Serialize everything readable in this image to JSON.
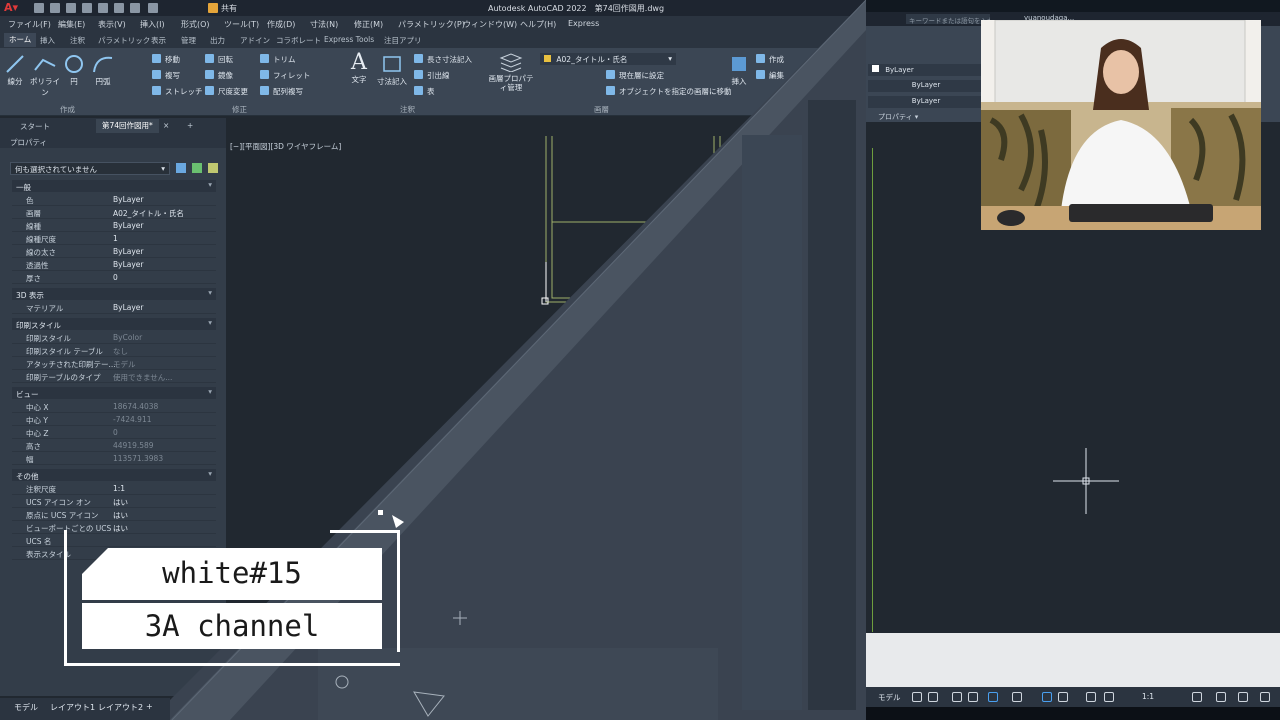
{
  "titlebar": {
    "title": "Autodesk AutoCAD 2022　第74回作図用.dwg",
    "share": "共有"
  },
  "menubar": [
    "ファイル(F)",
    "編集(E)",
    "表示(V)",
    "挿入(I)",
    "形式(O)",
    "ツール(T)",
    "作成(D)",
    "寸法(N)",
    "修正(M)",
    "パラメトリック(P)",
    "ウィンドウ(W)",
    "ヘルプ(H)",
    "Express"
  ],
  "ribbon_tabs": [
    "ホーム",
    "挿入",
    "注釈",
    "パラメトリック",
    "表示",
    "管理",
    "出力",
    "アドイン",
    "コラボレート",
    "Express Tools",
    "注目アプリ"
  ],
  "ribbon": {
    "draw": {
      "line": "線分",
      "polyline": "ポリライン",
      "circle": "円",
      "arc": "円弧",
      "group": "作成"
    },
    "modify": {
      "move": "移動",
      "rotate": "回転",
      "trim": "トリム",
      "copy": "複写",
      "mirror": "鏡像",
      "fillet": "フィレット",
      "stretch": "ストレッチ",
      "scale": "尺度変更",
      "array": "配列複写",
      "group": "修正"
    },
    "annotation": {
      "text": "文字",
      "dimension": "寸法記入",
      "linear": "長さ寸法記入",
      "leader": "引出線",
      "table": "表",
      "group": "注釈"
    },
    "layers": {
      "current": "A02_タイトル・氏名",
      "props": "画層プロパティ管理",
      "setcurrent": "現在層に設定",
      "matchlayer": "オブジェクトを指定の画層に移動",
      "group": "画層"
    },
    "block": {
      "insert": "挿入",
      "create": "作成",
      "edit": "編集"
    }
  },
  "doctabs": {
    "start": "スタート",
    "active": "第74回作図用*",
    "close": "×",
    "plus": "+"
  },
  "props": {
    "title": "プロパティ",
    "selection": "何も選択されていません",
    "general_title": "一般",
    "general": [
      [
        "色",
        "ByLayer"
      ],
      [
        "画層",
        "A02_タイトル・氏名"
      ],
      [
        "線種",
        "ByLayer"
      ],
      [
        "線種尺度",
        "1"
      ],
      [
        "線の太さ",
        "ByLayer"
      ],
      [
        "透過性",
        "ByLayer"
      ],
      [
        "厚さ",
        "0"
      ]
    ],
    "view3d_title": "3D 表示",
    "view3d": [
      [
        "マテリアル",
        "ByLayer"
      ]
    ],
    "plot_title": "印刷スタイル",
    "plot": [
      [
        "印刷スタイル",
        "ByColor"
      ],
      [
        "印刷スタイル テーブル",
        "なし"
      ],
      [
        "アタッチされた印刷テー...",
        "モデル"
      ],
      [
        "印刷テーブルのタイプ",
        "使用できません..."
      ]
    ],
    "view_title": "ビュー",
    "view": [
      [
        "中心 X",
        "18674.4038"
      ],
      [
        "中心 Y",
        "-7424.911"
      ],
      [
        "中心 Z",
        "0"
      ],
      [
        "高さ",
        "44919.589"
      ],
      [
        "幅",
        "113571.3983"
      ]
    ],
    "misc_title": "その他",
    "misc": [
      [
        "注釈尺度",
        "1:1"
      ],
      [
        "UCS アイコン オン",
        "はい"
      ],
      [
        "原点に UCS アイコン",
        "はい"
      ],
      [
        "ビューポートごとの UCS",
        "はい"
      ],
      [
        "UCS 名",
        ""
      ],
      [
        "表示スタイル",
        ""
      ]
    ]
  },
  "viewport_label": "[−][平面図][3D ワイヤフレーム]",
  "overlay": {
    "line1": "white#15",
    "line2": "3A channel"
  },
  "layout_tabs": {
    "model": "モデル",
    "layout1": "レイアウト1",
    "layout2": "レイアウト2",
    "plus": "+"
  },
  "right": {
    "search_placeholder": "キーワードまたは語句を入力",
    "user": "yuanoudaga...",
    "layer_color": "ByLayer",
    "linetype": "ByLayer",
    "lineweight": "ByLayer",
    "properties_label": "プロパティ ▾",
    "status_model": "モデル",
    "status_scale": "1:1"
  }
}
